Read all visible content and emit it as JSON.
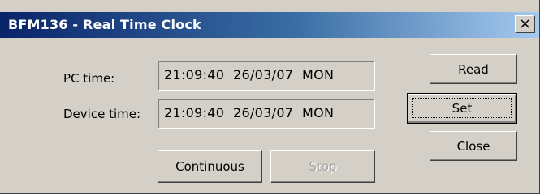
{
  "window": {
    "title": "BFM136 - Real Time Clock",
    "close_glyph": "×",
    "colors": {
      "face": "#d4d0c8",
      "title_start": "#0a246a",
      "title_end": "#a6caf0"
    }
  },
  "fields": {
    "pc_time": {
      "label": "PC time:",
      "value": "21:09:40  26/03/07  MON"
    },
    "device_time": {
      "label": "Device time:",
      "value": "21:09:40  26/03/07  MON"
    }
  },
  "buttons": {
    "read": "Read",
    "set": "Set",
    "close": "Close",
    "continuous": "Continuous",
    "stop": "Stop"
  }
}
